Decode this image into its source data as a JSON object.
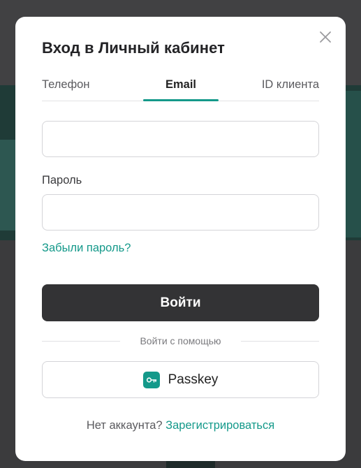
{
  "dialog": {
    "title": "Вход в Личный кабинет",
    "close_icon": "close-icon"
  },
  "tabs": [
    {
      "label": "Телефон",
      "active": false
    },
    {
      "label": "Email",
      "active": true
    },
    {
      "label": "ID клиента",
      "active": false
    }
  ],
  "form": {
    "email_value": "",
    "email_placeholder": "",
    "password_label": "Пароль",
    "password_value": "",
    "password_placeholder": "",
    "forgot_link": "Забыли пароль?",
    "submit_label": "Войти"
  },
  "alt_login": {
    "divider_text": "Войти с помощью",
    "passkey_label": "Passkey",
    "passkey_icon": "key-icon"
  },
  "footer": {
    "prompt": "Нет аккаунта?",
    "register_link": "Зарегистрироваться"
  },
  "colors": {
    "accent": "#14998a",
    "primary_button": "#333335",
    "overlay": "#3d3d3f"
  }
}
